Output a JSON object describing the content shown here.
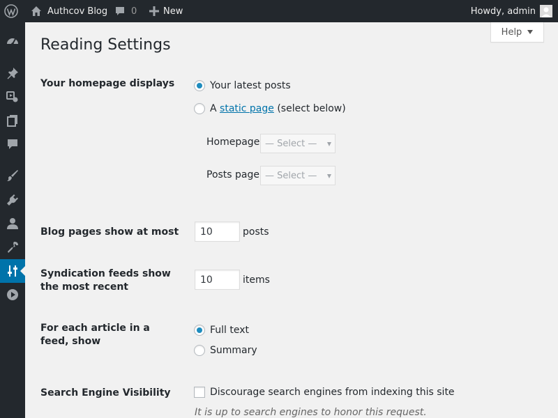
{
  "adminbar": {
    "site_name": "Authcov Blog",
    "comments_count": "0",
    "new_label": "New",
    "howdy": "Howdy, admin"
  },
  "sidemenu": {
    "items": [
      {
        "name": "dashboard",
        "icon": "dashboard-icon"
      },
      {
        "name": "posts",
        "icon": "pushpin-icon"
      },
      {
        "name": "media",
        "icon": "media-icon"
      },
      {
        "name": "pages",
        "icon": "pages-icon"
      },
      {
        "name": "comments",
        "icon": "comment-icon"
      },
      {
        "name": "appearance",
        "icon": "paintbrush-icon"
      },
      {
        "name": "plugins",
        "icon": "plug-icon"
      },
      {
        "name": "users",
        "icon": "user-icon"
      },
      {
        "name": "tools",
        "icon": "wrench-icon"
      },
      {
        "name": "settings",
        "icon": "settings-sliders-icon",
        "current": true
      },
      {
        "name": "media-player",
        "icon": "play-circle-icon"
      }
    ],
    "accent": "#0073aa"
  },
  "help": {
    "label": "Help"
  },
  "page": {
    "title": "Reading Settings"
  },
  "homepage_displays": {
    "label": "Your homepage displays",
    "option_latest": "Your latest posts",
    "option_static_prefix": "A",
    "option_static_link": "static page",
    "option_static_suffix": "(select below)",
    "selected": "latest",
    "homepage_label": "Homepage:",
    "homepage_value": "— Select —",
    "posts_page_label": "Posts page:",
    "posts_page_value": "— Select —"
  },
  "blog_pages": {
    "label": "Blog pages show at most",
    "value": "10",
    "unit": "posts"
  },
  "syndication": {
    "label": "Syndication feeds show the most recent",
    "value": "10",
    "unit": "items"
  },
  "feed_article": {
    "label": "For each article in a feed, show",
    "option_full": "Full text",
    "option_summary": "Summary",
    "selected": "full"
  },
  "search_visibility": {
    "label": "Search Engine Visibility",
    "checkbox_label": "Discourage search engines from indexing this site",
    "checked": false,
    "description": "It is up to search engines to honor this request."
  }
}
